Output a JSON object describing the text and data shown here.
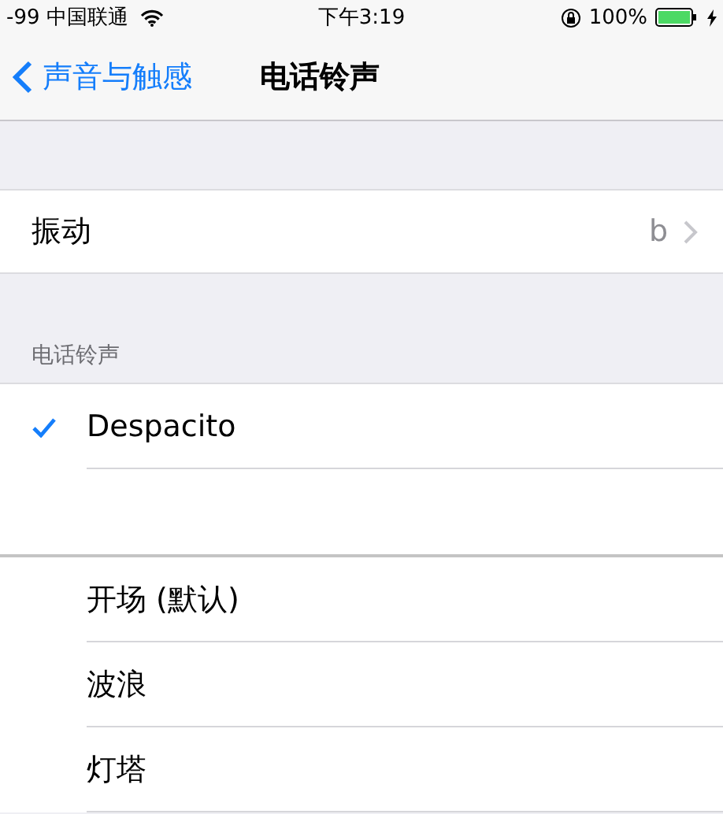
{
  "status_bar": {
    "carrier": "-99 中国联通",
    "time": "下午3:19",
    "battery": "100%"
  },
  "nav": {
    "back": "声音与触感",
    "title": "电话铃声"
  },
  "vibration": {
    "label": "振动",
    "value": "b"
  },
  "ringtones_header": "电话铃声",
  "custom_ringtones": [
    {
      "name": "Despacito",
      "selected": true
    }
  ],
  "ringtones": [
    {
      "name": "开场 (默认)",
      "selected": false
    },
    {
      "name": "波浪",
      "selected": false
    },
    {
      "name": "灯塔",
      "selected": false
    }
  ]
}
